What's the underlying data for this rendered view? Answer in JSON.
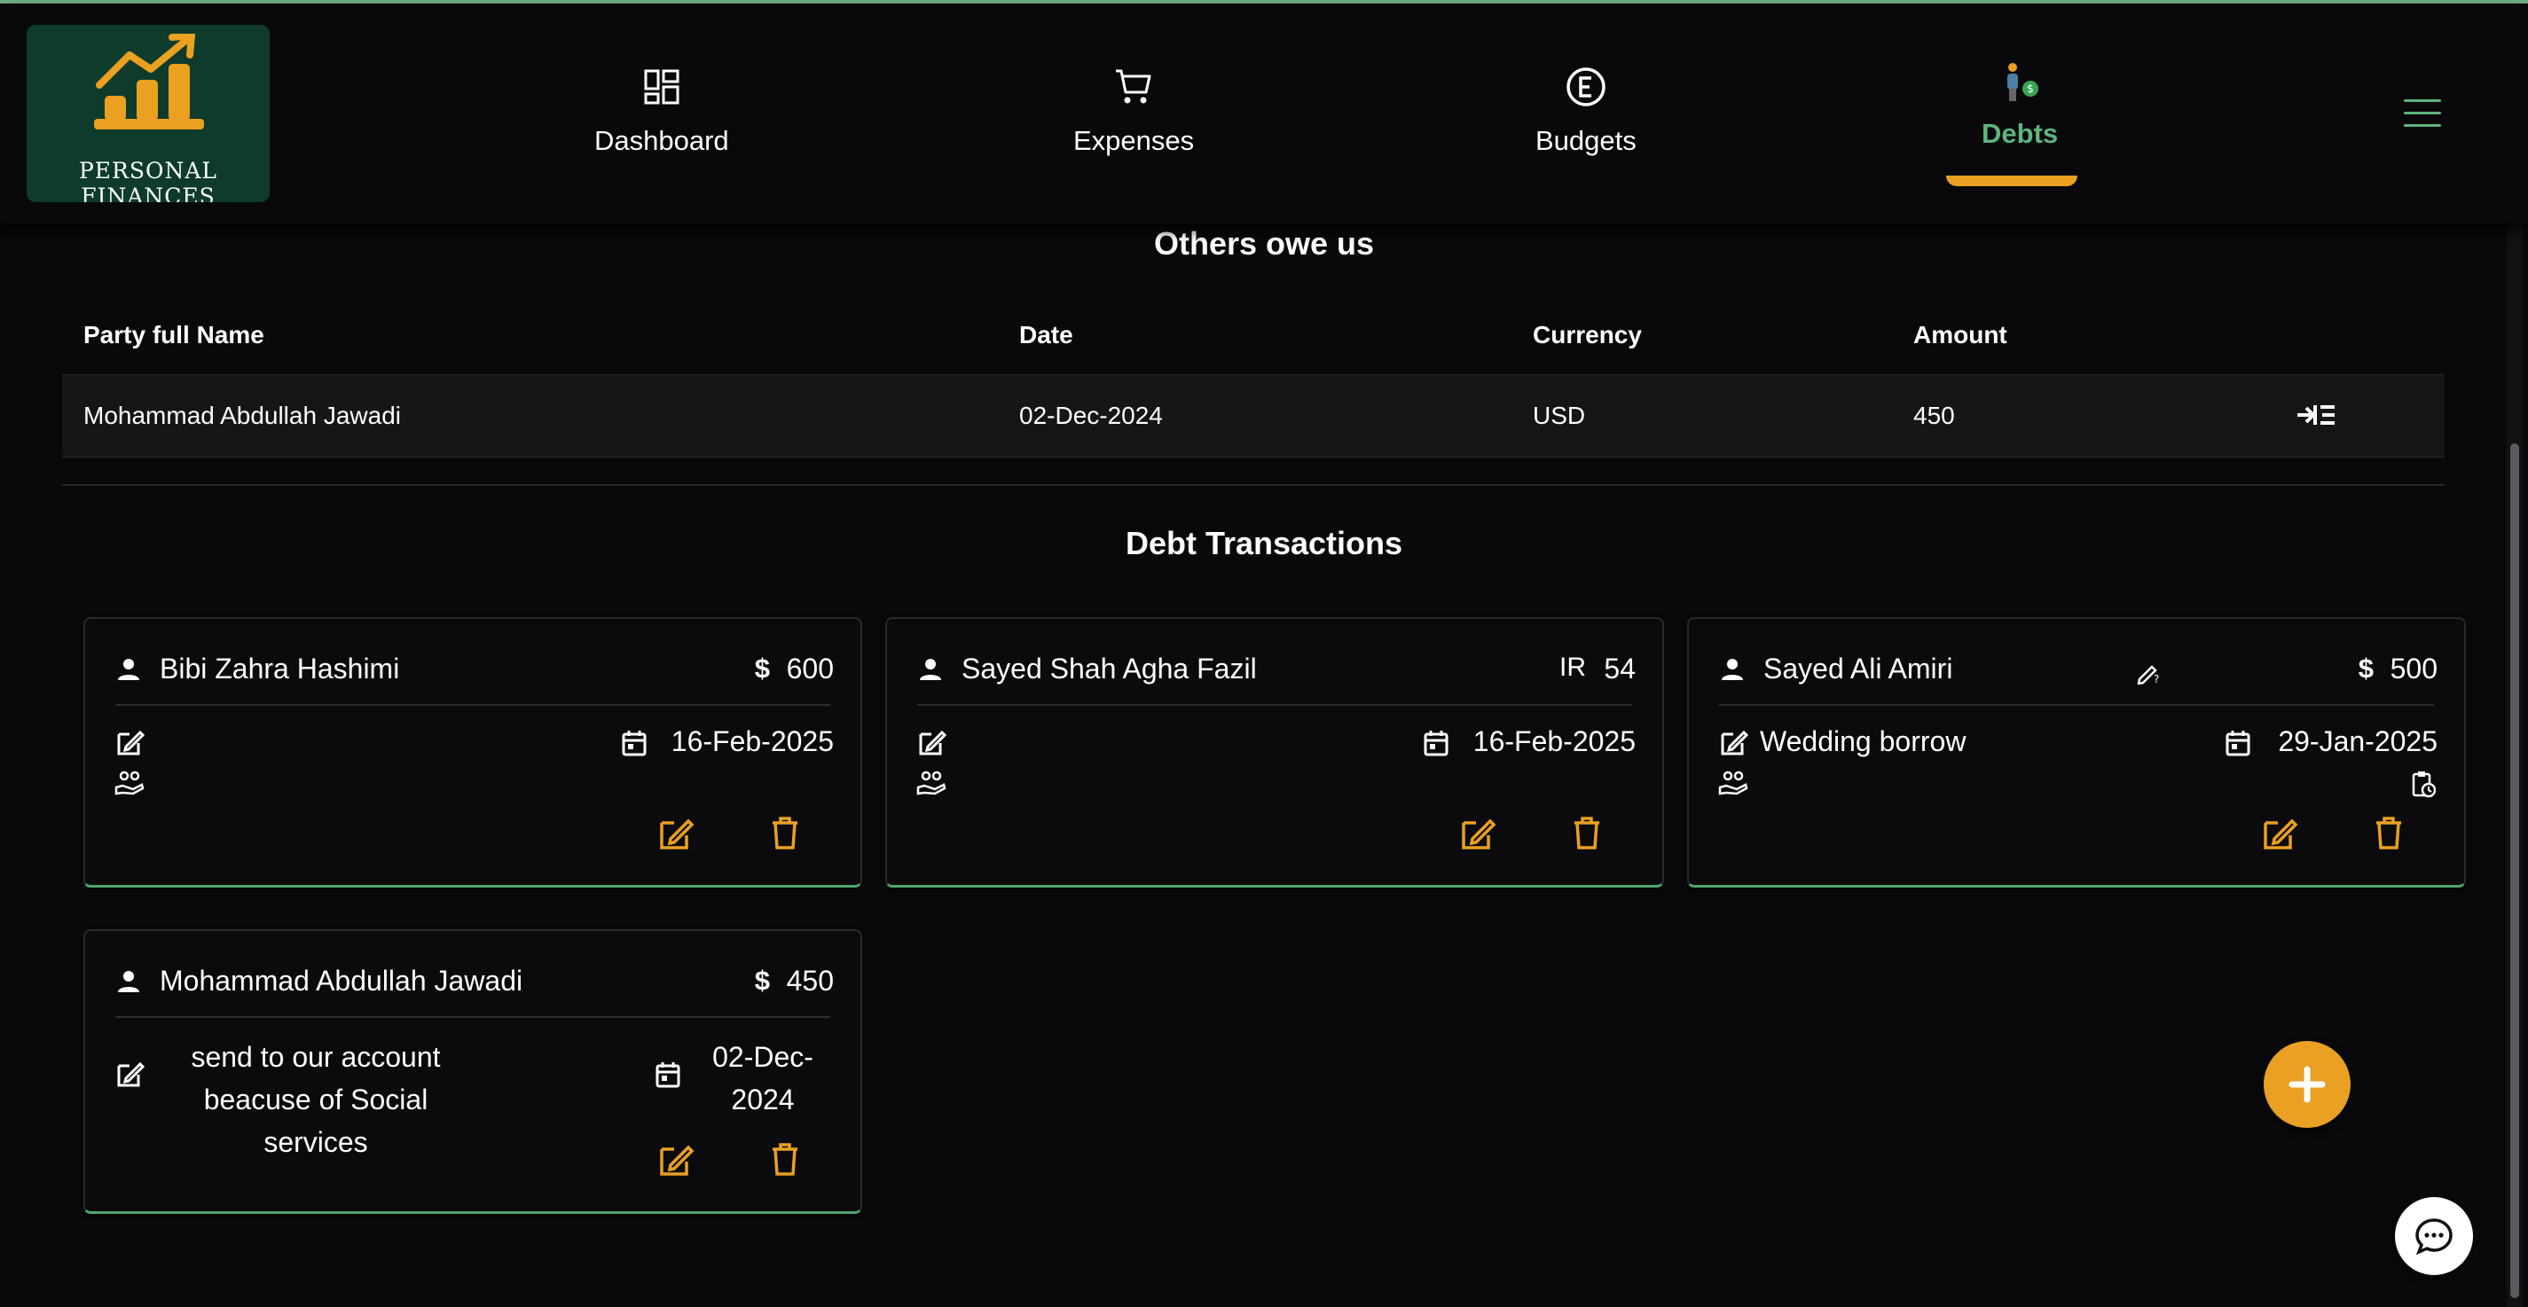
{
  "app": {
    "logo_text": "PERSONAL FINANCES"
  },
  "nav": {
    "items": [
      {
        "label": "Dashboard",
        "icon": "dashboard-icon"
      },
      {
        "label": "Expenses",
        "icon": "cart-icon"
      },
      {
        "label": "Budgets",
        "icon": "euro-circle-icon"
      },
      {
        "label": "Debts",
        "icon": "person-money-icon",
        "active": true
      }
    ]
  },
  "others_owe": {
    "title": "Others owe us",
    "columns": [
      "Party full Name",
      "Date",
      "Currency",
      "Amount"
    ],
    "rows": [
      {
        "name": "Mohammad Abdullah Jawadi",
        "date": "02-Dec-2024",
        "currency": "USD",
        "amount": "450"
      }
    ]
  },
  "transactions": {
    "title": "Debt Transactions",
    "cards": [
      {
        "name": "Bibi Zahra Hashimi",
        "currency_symbol": "$",
        "amount": "600",
        "note": "",
        "date": "16-Feb-2025"
      },
      {
        "name": "Sayed Shah Agha Fazil",
        "currency_symbol": "IR",
        "amount": "54",
        "note": "",
        "date": "16-Feb-2025"
      },
      {
        "name": "Sayed Ali Amiri",
        "currency_symbol": "$",
        "amount": "500",
        "note": "Wedding borrow",
        "date": "29-Jan-2025"
      },
      {
        "name": "Mohammad Abdullah Jawadi",
        "currency_symbol": "$",
        "amount": "450",
        "note": "send to our account beacuse of Social services",
        "date": "02-Dec-2024"
      }
    ]
  },
  "colors": {
    "accent_orange": "#eaa021",
    "accent_green": "#5fb47d",
    "background": "#09090b",
    "logo_bg": "#0e3b2c"
  }
}
